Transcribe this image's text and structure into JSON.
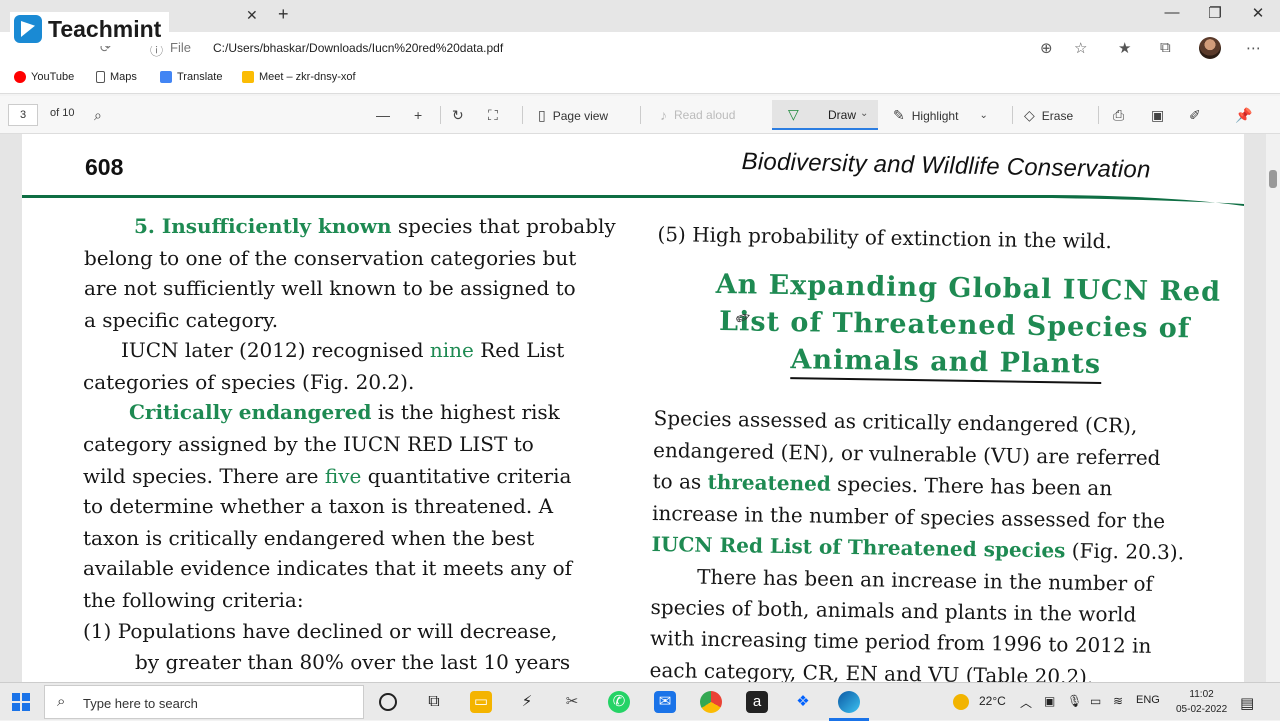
{
  "browser": {
    "logo_text": "Teachmint",
    "url": "C:/Users/bhaskar/Downloads/Iucn%20red%20data.pdf",
    "file_label": "File"
  },
  "bookmarks": [
    {
      "label": "YouTube",
      "icon": "youtube-icon",
      "color": "#ff0000"
    },
    {
      "label": "Maps",
      "icon": "bookmark-icon",
      "color": "#555555"
    },
    {
      "label": "Translate",
      "icon": "translate-icon",
      "color": "#4285f4"
    },
    {
      "label": "Meet – zkr-dnsy-xof",
      "icon": "meet-icon",
      "color": "#00897b"
    }
  ],
  "pdf_toolbar": {
    "page_current": "3",
    "page_total": "of 10",
    "page_view": "Page view",
    "read_aloud": "Read aloud",
    "draw": "Draw",
    "highlight": "Highlight",
    "erase": "Erase"
  },
  "document": {
    "page_number": "608",
    "running_head": "Biodiversity and Wildlife Conservation",
    "left_lines": [
      {
        "parts": [
          {
            "t": "5. Insufficiently known",
            "c": "g"
          },
          {
            "t": " species that probably"
          }
        ]
      },
      {
        "parts": [
          {
            "t": "belong to one of the conservation categories but"
          }
        ]
      },
      {
        "parts": [
          {
            "t": "are not sufficiently well known to be assigned to"
          }
        ]
      },
      {
        "parts": [
          {
            "t": "a specific category."
          }
        ]
      },
      {
        "parts": [
          {
            "t": "IUCN later (2012) recognised "
          },
          {
            "t": "nine",
            "c": "gs"
          },
          {
            "t": " Red List"
          }
        ]
      },
      {
        "parts": [
          {
            "t": "categories of species (Fig. 20.2)."
          }
        ]
      },
      {
        "parts": [
          {
            "t": "Critically endangered",
            "c": "g"
          },
          {
            "t": " is the highest risk"
          }
        ]
      },
      {
        "parts": [
          {
            "t": "category assigned by the IUCN RED LIST to"
          }
        ]
      },
      {
        "parts": [
          {
            "t": "wild species. There are "
          },
          {
            "t": "five",
            "c": "gs"
          },
          {
            "t": " quantitative criteria"
          }
        ]
      },
      {
        "parts": [
          {
            "t": "to determine whether a taxon is threatened. A"
          }
        ]
      },
      {
        "parts": [
          {
            "t": "taxon is critically endangered when the best"
          }
        ]
      },
      {
        "parts": [
          {
            "t": "available evidence indicates that it meets any of"
          }
        ]
      },
      {
        "parts": [
          {
            "t": "the following criteria:"
          }
        ]
      },
      {
        "parts": [
          {
            "t": "(1)  Populations have declined or will decrease,"
          }
        ]
      },
      {
        "parts": [
          {
            "t": "by greater than 80% over the last 10 years"
          }
        ]
      }
    ],
    "right_top": "(5)  High probability of extinction in the wild.",
    "right_heading": [
      "An Expanding Global IUCN Red",
      "List of Threatened Species of",
      "Animals and Plants"
    ],
    "right_lines": [
      {
        "parts": [
          {
            "t": "Species assessed as critically endangered (CR),"
          }
        ]
      },
      {
        "parts": [
          {
            "t": "endangered (EN), or vulnerable (VU) are referred"
          }
        ]
      },
      {
        "parts": [
          {
            "t": "to as "
          },
          {
            "t": "threatened",
            "c": "g"
          },
          {
            "t": " species. There has been an"
          }
        ]
      },
      {
        "parts": [
          {
            "t": "increase in the number of species assessed for the"
          }
        ]
      },
      {
        "parts": [
          {
            "t": "IUCN Red List of Threatened species",
            "c": "g"
          },
          {
            "t": " (Fig. 20.3)."
          }
        ]
      },
      {
        "parts": [
          {
            "t": "There has been an increase in the number of"
          }
        ]
      },
      {
        "parts": [
          {
            "t": "species of both, animals and plants in the world"
          }
        ]
      },
      {
        "parts": [
          {
            "t": "with increasing time period from 1996 to 2012 in"
          }
        ]
      },
      {
        "parts": [
          {
            "t": "each category, CR, EN and VU (Table 20.2)."
          }
        ]
      }
    ]
  },
  "taskbar": {
    "search_placeholder": "Type here to search",
    "temperature": "22°C",
    "language": "ENG",
    "time": "11:02",
    "date": "05-02-2022"
  }
}
